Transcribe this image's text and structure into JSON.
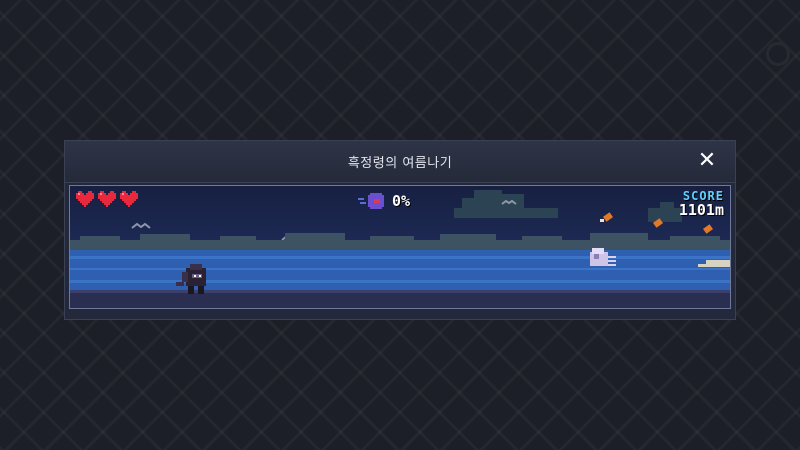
{
  "modal": {
    "title": "흑정령의 여름나기",
    "close_label": "✕"
  },
  "hud": {
    "lives": 3,
    "progress_text": "0%",
    "score_label": "SCORE",
    "score_value": "1101m"
  },
  "colors": {
    "heart": "#e8283c",
    "score_label": "#5fd0ff",
    "sea": "#2f5fb0",
    "cloud": "#2b4353"
  },
  "icons": [
    "heart-icon",
    "spirit-progress-icon",
    "close-icon"
  ]
}
